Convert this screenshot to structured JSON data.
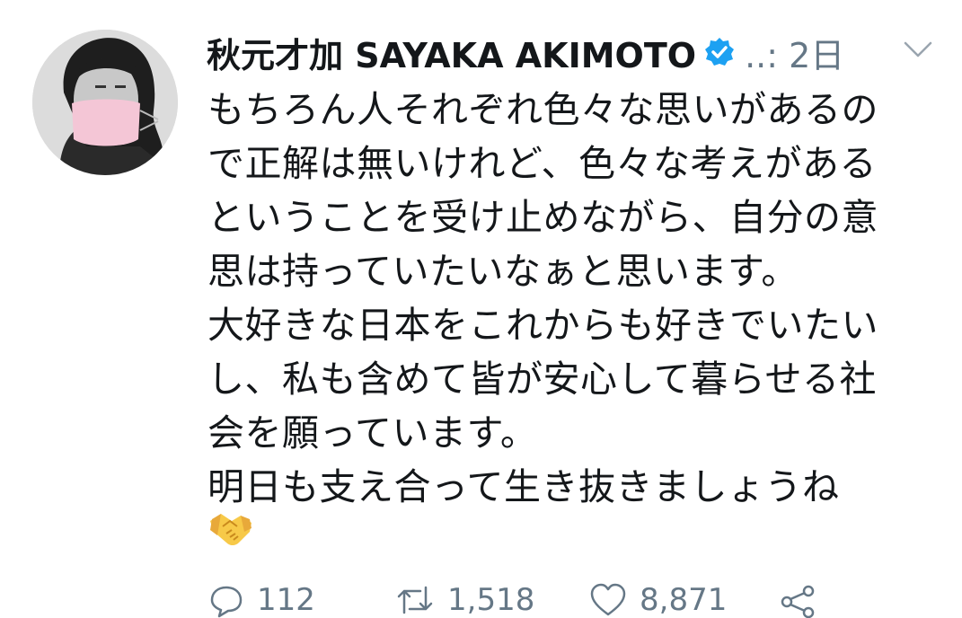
{
  "tweet": {
    "author_name": "秋元才加 SAYAKA AKIMOTO",
    "meta": "..: 2日",
    "lines": [
      "もちろん人それぞれ色々な思いがあるの",
      "で正解は無いけれど、色々な考えがある",
      "ということを受け止めながら、自分の意",
      "思は持っていたいなぁと思います。",
      "大好きな日本をこれからも好きでいたい",
      "し、私も含めて皆が安心して暮らせる社",
      "会を願っています。",
      "明日も支え合って生き抜きましょうね"
    ],
    "emoji": "handshake-emoji"
  },
  "actions": {
    "reply_count": "112",
    "retweet_count": "1,518",
    "like_count": "8,871"
  },
  "icons": {
    "verified": "verified-badge-icon",
    "caret": "chevron-down-icon",
    "reply": "reply-icon",
    "retweet": "retweet-icon",
    "like": "heart-icon",
    "share": "share-icon"
  },
  "colors": {
    "accent": "#1da1f2",
    "text": "#14171a",
    "secondary": "#657786"
  }
}
